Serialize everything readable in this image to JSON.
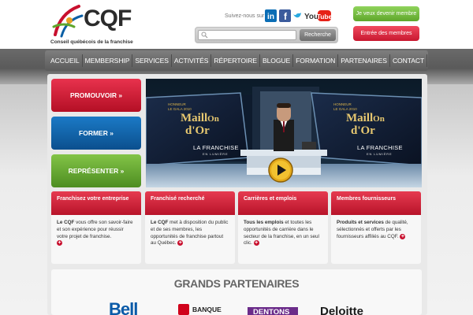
{
  "header": {
    "logo_text": "CQF",
    "logo_subtitle": "Conseil québécois de la franchise",
    "follow_label": "Suivez-nous sur",
    "social": [
      "linkedin-icon",
      "facebook-icon",
      "twitter-icon",
      "youtube-icon"
    ],
    "youtube_text": "YouTube",
    "search": {
      "placeholder": "",
      "value": "",
      "button": "Recherche"
    },
    "cta_member": "Je veux devenir membre",
    "cta_login": "Entrée des membres"
  },
  "nav": {
    "items": [
      "ACCUEIL",
      "MEMBERSHIP",
      "SERVICES",
      "ACTIVITÉS",
      "RÉPERTOIRE",
      "BLOGUE",
      "FORMATION",
      "PARTENAIRES",
      "CONTACT"
    ]
  },
  "side_buttons": [
    "PROMOUVOIR »",
    "FORMER »",
    "REPRÉSENTER »"
  ],
  "video": {
    "screen_left": {
      "line1": "HONNEUR",
      "line2": "LE GALA 2010",
      "logo_a": "Maill",
      "logo_b": "On",
      "logo_c": "d'Or"
    },
    "screen_right": {
      "line1": "HONNEUR",
      "line2": "LE GALA 2010",
      "logo_a": "Maill",
      "logo_b": "On",
      "logo_c": "d'Or"
    },
    "caption_left_1": "LA FRANCHISE",
    "caption_left_2": "EN LUMIÈRE",
    "caption_right_1": "LA FRANCHISE",
    "caption_right_2": "EN LUMIÈRE"
  },
  "cards": [
    {
      "title": "Franchisez votre entreprise",
      "lead": "Le CQF",
      "text": " vous offre son savoir-faire et son expérience pour réussir votre projet de franchise."
    },
    {
      "title": "Franchisé recherché",
      "lead": "Le CQF",
      "text": " met à disposition du public et de ses membres, les opportunités de franchise partout au Québec."
    },
    {
      "title": "Carrières et emplois",
      "lead": "Tous les emplois",
      "text": " et toutes les opportunités de carrière dans le secteur de la franchise, en un seul clic."
    },
    {
      "title": "Membres fournisseurs",
      "lead": "Produits et services",
      "text": " de qualité, sélectionnés et offerts par les fournisseurs affiliés au CQF."
    }
  ],
  "partners": {
    "title": "GRANDS PARTENAIRES",
    "logos": [
      "Bell",
      "BANQUE",
      "DENTONS",
      "Deloitte"
    ]
  },
  "colors": {
    "red": "#c8102e",
    "blue": "#0b5fa5",
    "green": "#5fa62b",
    "nav": "#666666"
  }
}
